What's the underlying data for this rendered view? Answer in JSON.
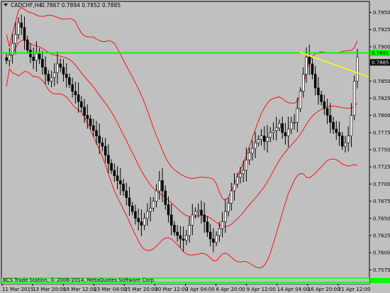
{
  "header": {
    "collapse_icon": "triangle-down-icon",
    "symbol": "CADCHF,H4",
    "ohlc": "0.7867 0.7894 0.7852 0.7885"
  },
  "footer": {
    "copyright": "BCS Trade Station, © 2006-2014, MetaQuotes Software Corp."
  },
  "prices": {
    "current": "0.7885",
    "resistance": "0.7891"
  },
  "colors": {
    "background": "#c0c0c0",
    "bull_candle": "#000000",
    "bear_candle": "#000000",
    "bollinger": "#ff0000",
    "resistance_line": "#00ff00",
    "trend_line": "#ffff00",
    "text": "#000000"
  },
  "chart_data": {
    "type": "candlestick",
    "y_ticks": [
      "0.7950",
      "0.7925",
      "0.7900",
      "0.7875",
      "0.7850",
      "0.7825",
      "0.7800",
      "0.7775",
      "0.7750",
      "0.7725",
      "0.7700",
      "0.7675",
      "0.7650",
      "0.7625",
      "0.7600",
      "0.7575"
    ],
    "x_ticks": [
      "11 Mar 2015",
      "13 Mar 20:00",
      "18 Mar 12:00",
      "23 Mar 04:00",
      "25 Mar 20:00",
      "30 Mar 12:00",
      "2 Apr 04:00",
      "6 Apr 20:00",
      "9 Apr 12:00",
      "14 Apr 04:00",
      "16 Apr 20:00",
      "21 Apr 12:00"
    ],
    "ylim": [
      0.7565,
      0.7965
    ],
    "resistance_level": 0.7891,
    "trend_line": {
      "from": [
        "14 Apr 04:00",
        0.7892
      ],
      "to": [
        "21 Apr 12:00",
        0.7856
      ]
    },
    "bollinger": {
      "period": "unlabeled",
      "color": "#ff0000"
    },
    "closes": [
      0.788,
      0.7888,
      0.7905,
      0.7918,
      0.7935,
      0.7928,
      0.791,
      0.7895,
      0.7885,
      0.788,
      0.789,
      0.7882,
      0.787,
      0.786,
      0.785,
      0.7855,
      0.7862,
      0.7875,
      0.787,
      0.786,
      0.7855,
      0.7845,
      0.7835,
      0.783,
      0.782,
      0.7812,
      0.78,
      0.7795,
      0.7785,
      0.7778,
      0.777,
      0.776,
      0.7755,
      0.7742,
      0.773,
      0.772,
      0.7712,
      0.7705,
      0.77,
      0.769,
      0.768,
      0.7668,
      0.766,
      0.765,
      0.7645,
      0.764,
      0.765,
      0.766,
      0.7665,
      0.7675,
      0.769,
      0.7705,
      0.769,
      0.767,
      0.7655,
      0.764,
      0.763,
      0.7625,
      0.762,
      0.7618,
      0.7625,
      0.764,
      0.7655,
      0.766,
      0.7662,
      0.7655,
      0.7645,
      0.763,
      0.762,
      0.7615,
      0.7625,
      0.7635,
      0.7645,
      0.766,
      0.7672,
      0.769,
      0.77,
      0.771,
      0.7715,
      0.772,
      0.7735,
      0.7745,
      0.7752,
      0.776,
      0.7765,
      0.777,
      0.7762,
      0.7768,
      0.7775,
      0.7778,
      0.7782,
      0.7788,
      0.7775,
      0.777,
      0.778,
      0.779,
      0.779,
      0.781,
      0.7835,
      0.786,
      0.7885,
      0.7875,
      0.786,
      0.784,
      0.783,
      0.782,
      0.781,
      0.78,
      0.779,
      0.778,
      0.7775,
      0.777,
      0.7755,
      0.776,
      0.777,
      0.78,
      0.785,
      0.7885
    ]
  }
}
